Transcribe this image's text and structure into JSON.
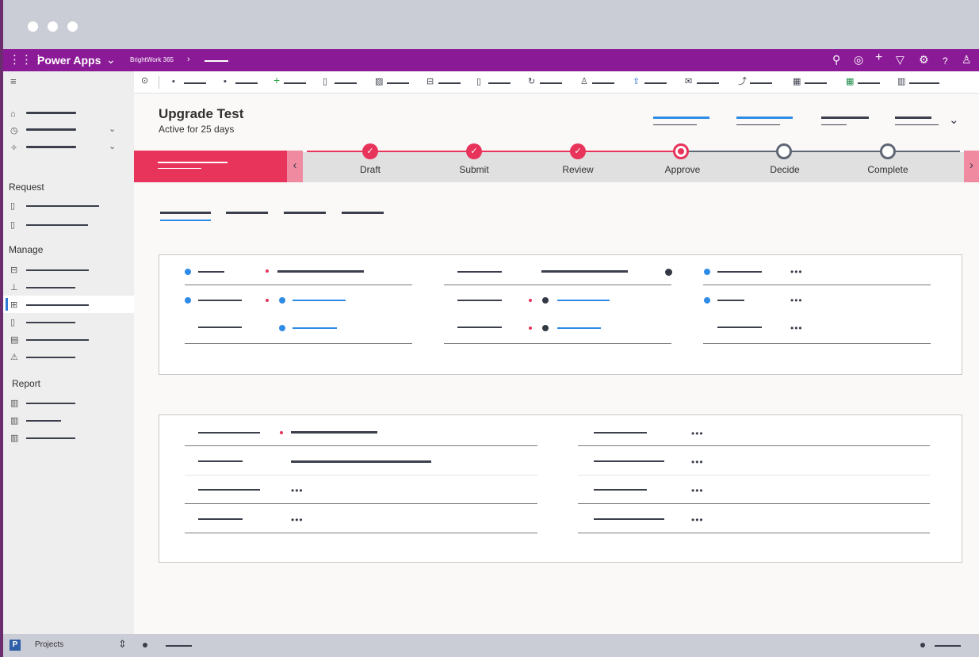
{
  "app": {
    "name": "Power Apps",
    "breadcrumb": "BrightWork 365",
    "breadcrumb_sep": "›"
  },
  "header_icons": [
    "search-icon",
    "target-icon",
    "plus-icon",
    "filter-icon",
    "gear-icon",
    "help-icon",
    "person-icon"
  ],
  "record": {
    "title": "Upgrade Test",
    "status": "Active for 25 days"
  },
  "bpf": {
    "stages": [
      {
        "label": "Draft",
        "state": "done"
      },
      {
        "label": "Submit",
        "state": "done"
      },
      {
        "label": "Review",
        "state": "done"
      },
      {
        "label": "Approve",
        "state": "active"
      },
      {
        "label": "Decide",
        "state": "pending"
      },
      {
        "label": "Complete",
        "state": "pending"
      }
    ]
  },
  "sidebar": {
    "sections": [
      "Request",
      "Manage",
      "Report"
    ]
  },
  "footer": {
    "area_letter": "P",
    "area_name": "Projects"
  },
  "ellipsis": "•••",
  "colors": {
    "accent": "#8b1a96",
    "stage_active": "#e8335a",
    "stage_pending": "#5f6774",
    "link": "#2e8be6"
  }
}
